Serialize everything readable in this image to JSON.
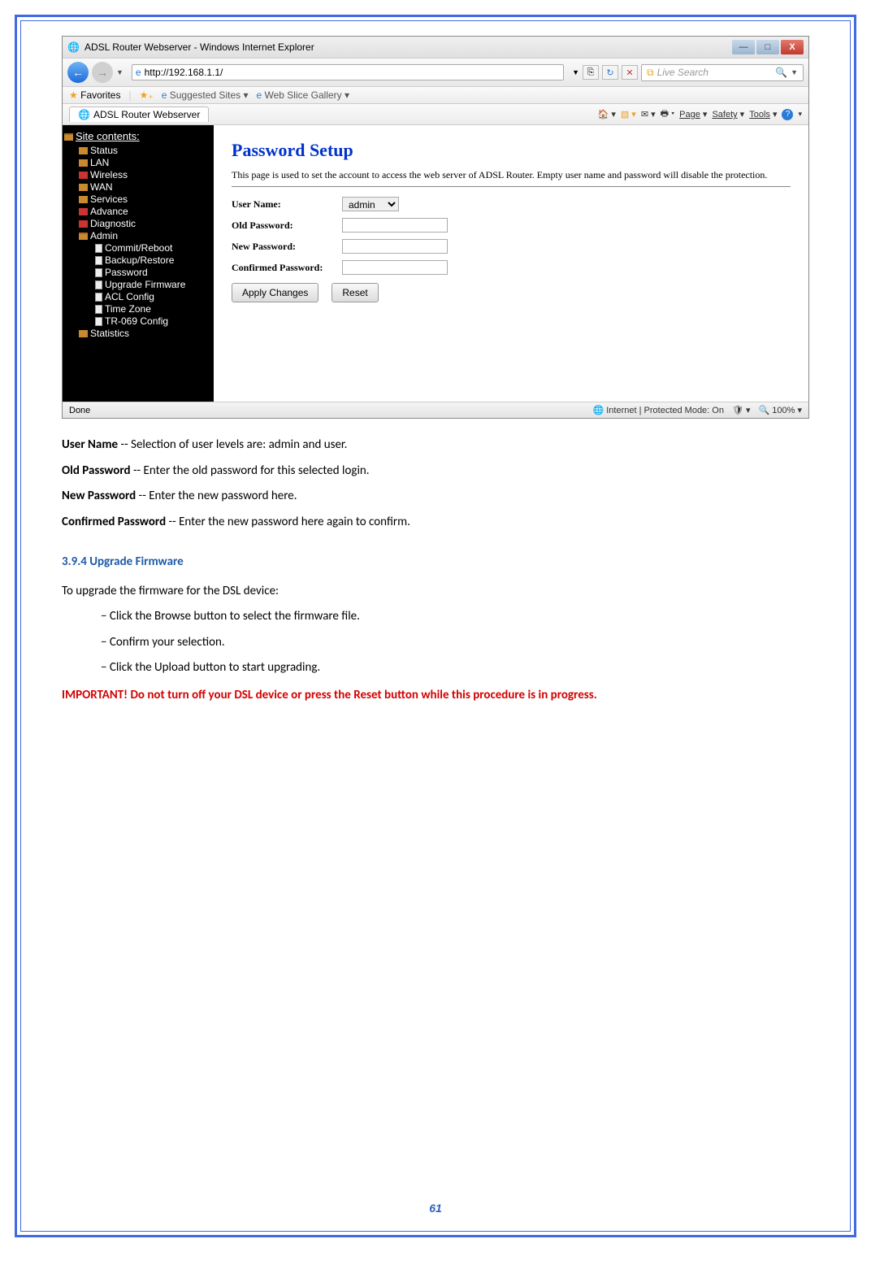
{
  "ie": {
    "title": "ADSL Router Webserver - Windows Internet Explorer",
    "url": "http://192.168.1.1/",
    "search_placeholder": "Live Search",
    "favorites_label": "Favorites",
    "suggested": "Suggested Sites",
    "webslice": "Web Slice Gallery",
    "tab_title": "ADSL Router Webserver",
    "menu": {
      "page": "Page",
      "safety": "Safety",
      "tools": "Tools"
    },
    "status_left": "Done",
    "status_mid": "Internet | Protected Mode: On",
    "status_zoom": "100%"
  },
  "sidebar": {
    "header": "Site contents:",
    "items": [
      "Status",
      "LAN",
      "Wireless",
      "WAN",
      "Services",
      "Advance",
      "Diagnostic",
      "Admin"
    ],
    "admin_children": [
      "Commit/Reboot",
      "Backup/Restore",
      "Password",
      "Upgrade Firmware",
      "ACL Config",
      "Time Zone",
      "TR-069 Config"
    ],
    "last": "Statistics"
  },
  "panel": {
    "heading": "Password Setup",
    "desc": "This page is used to set the account to access the web server of ADSL Router. Empty user name and password will disable the protection.",
    "labels": {
      "username": "User Name:",
      "username_value": "admin",
      "oldpw": "Old Password:",
      "newpw": "New Password:",
      "confpw": "Confirmed Password:"
    },
    "buttons": {
      "apply": "Apply Changes",
      "reset": "Reset"
    }
  },
  "doc": {
    "p1_b": "User Name",
    "p1_t": " -- Selection of user levels are: admin and user.",
    "p2_b": "Old Password",
    "p2_t": " -- Enter the old password for this selected login.",
    "p3_b": "New Password",
    "p3_t": " -- Enter the new password here.",
    "p4_b": "Confirmed Password",
    "p4_t": " -- Enter the new password here again to confirm.",
    "section": "3.9.4 Upgrade Firmware",
    "intro": "To upgrade the firmware for the DSL device:",
    "step1": "− Click the Browse button to select the firmware file.",
    "step2": "− Confirm your selection.",
    "step3": "− Click the Upload button to start upgrading.",
    "important": "IMPORTANT! Do not turn off your DSL device or press the Reset button while this procedure is in progress."
  },
  "page_number": "61"
}
